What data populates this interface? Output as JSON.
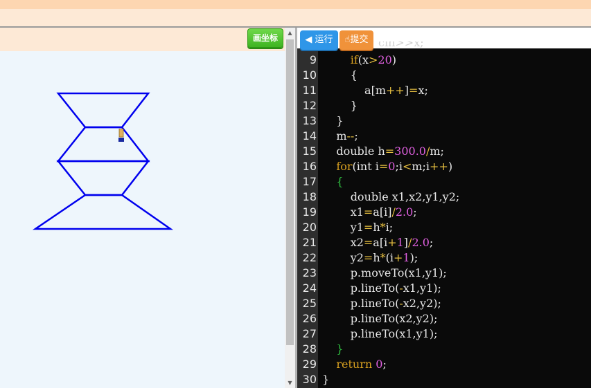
{
  "toolbar": {
    "draw_coords_label": "画坐标",
    "run_label": "◀ 运行",
    "submit_label": "提交"
  },
  "editor": {
    "partial_top_line": "cin>>x;",
    "lines": [
      {
        "num": "9",
        "tokens": [
          [
            "pl",
            "        "
          ],
          [
            "kw",
            "if"
          ],
          [
            "pl",
            "(x"
          ],
          [
            "op",
            ">"
          ],
          [
            "num",
            "20"
          ],
          [
            "pl",
            ")"
          ]
        ]
      },
      {
        "num": "10",
        "tokens": [
          [
            "pl",
            "        {"
          ]
        ]
      },
      {
        "num": "11",
        "tokens": [
          [
            "pl",
            "            a[m"
          ],
          [
            "op",
            "++"
          ],
          [
            "pl",
            "]"
          ],
          [
            "op",
            "="
          ],
          [
            "pl",
            "x;"
          ]
        ]
      },
      {
        "num": "12",
        "tokens": [
          [
            "pl",
            "        }"
          ]
        ]
      },
      {
        "num": "13",
        "tokens": [
          [
            "pl",
            "    }"
          ]
        ]
      },
      {
        "num": "14",
        "tokens": [
          [
            "pl",
            "    m"
          ],
          [
            "op",
            "--"
          ],
          [
            "pl",
            ";"
          ]
        ]
      },
      {
        "num": "15",
        "tokens": [
          [
            "pl",
            "    double h"
          ],
          [
            "op",
            "="
          ],
          [
            "num",
            "300.0"
          ],
          [
            "op",
            "/"
          ],
          [
            "pl",
            "m;"
          ]
        ]
      },
      {
        "num": "16",
        "tokens": [
          [
            "pl",
            "    "
          ],
          [
            "kw",
            "for"
          ],
          [
            "pl",
            "(int i"
          ],
          [
            "op",
            "="
          ],
          [
            "num",
            "0"
          ],
          [
            "pl",
            ";i"
          ],
          [
            "op",
            "<"
          ],
          [
            "pl",
            "m;i"
          ],
          [
            "op",
            "++"
          ],
          [
            "pl",
            ")"
          ]
        ]
      },
      {
        "num": "17",
        "tokens": [
          [
            "pl",
            "    "
          ],
          [
            "br",
            "{"
          ]
        ]
      },
      {
        "num": "18",
        "tokens": [
          [
            "pl",
            "        double x1,x2,y1,y2;"
          ]
        ]
      },
      {
        "num": "19",
        "tokens": [
          [
            "pl",
            "        x1"
          ],
          [
            "op",
            "="
          ],
          [
            "pl",
            "a[i]"
          ],
          [
            "op",
            "/"
          ],
          [
            "num",
            "2.0"
          ],
          [
            "pl",
            ";"
          ]
        ]
      },
      {
        "num": "20",
        "tokens": [
          [
            "pl",
            "        y1"
          ],
          [
            "op",
            "="
          ],
          [
            "pl",
            "h"
          ],
          [
            "op",
            "*"
          ],
          [
            "pl",
            "i;"
          ]
        ]
      },
      {
        "num": "21",
        "tokens": [
          [
            "pl",
            "        x2"
          ],
          [
            "op",
            "="
          ],
          [
            "pl",
            "a[i"
          ],
          [
            "op",
            "+"
          ],
          [
            "num",
            "1"
          ],
          [
            "pl",
            "]"
          ],
          [
            "op",
            "/"
          ],
          [
            "num",
            "2.0"
          ],
          [
            "pl",
            ";"
          ]
        ]
      },
      {
        "num": "22",
        "tokens": [
          [
            "pl",
            "        y2"
          ],
          [
            "op",
            "="
          ],
          [
            "pl",
            "h"
          ],
          [
            "op",
            "*"
          ],
          [
            "pl",
            "(i"
          ],
          [
            "op",
            "+"
          ],
          [
            "num",
            "1"
          ],
          [
            "pl",
            ");"
          ]
        ]
      },
      {
        "num": "23",
        "tokens": [
          [
            "pl",
            "        p.moveTo(x1,y1);"
          ]
        ]
      },
      {
        "num": "24",
        "tokens": [
          [
            "pl",
            "        p.lineTo("
          ],
          [
            "op",
            "-"
          ],
          [
            "pl",
            "x1,y1);"
          ]
        ]
      },
      {
        "num": "25",
        "tokens": [
          [
            "pl",
            "        p.lineTo("
          ],
          [
            "op",
            "-"
          ],
          [
            "pl",
            "x2,y2);"
          ]
        ]
      },
      {
        "num": "26",
        "tokens": [
          [
            "pl",
            "        p.lineTo(x2,y2);"
          ]
        ]
      },
      {
        "num": "27",
        "tokens": [
          [
            "pl",
            "        p.lineTo(x1,y1);"
          ]
        ]
      },
      {
        "num": "28",
        "tokens": [
          [
            "pl",
            "    "
          ],
          [
            "br",
            "}"
          ]
        ]
      },
      {
        "num": "29",
        "tokens": [
          [
            "pl",
            "    "
          ],
          [
            "kw",
            "return"
          ],
          [
            "pl",
            " "
          ],
          [
            "num",
            "0"
          ],
          [
            "pl",
            ";"
          ]
        ]
      },
      {
        "num": "30",
        "tokens": [
          [
            "pl",
            "}"
          ]
        ]
      }
    ]
  },
  "colors": {
    "drawing_stroke": "#0000ee",
    "keyword": "#d8a020",
    "number": "#e060e0",
    "operator": "#e8c040",
    "bracket": "#30c040"
  },
  "icons": {
    "pencil": "pencil-icon",
    "scroll_up": "scroll-up-icon",
    "scroll_down": "scroll-down-icon",
    "submit": "hand-icon"
  }
}
